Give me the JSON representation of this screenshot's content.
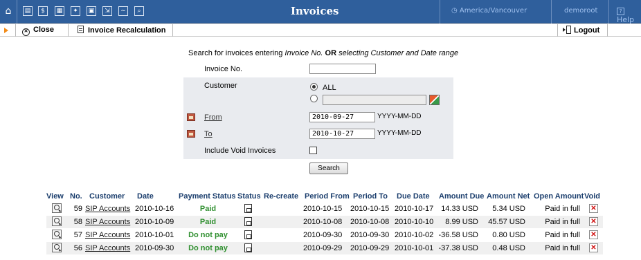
{
  "header": {
    "title": "Invoices",
    "timezone": "America/Vancouver",
    "user": "demoroot",
    "help": "Help",
    "nav_glyphs": [
      "⌂",
      "▤",
      "$",
      "▦",
      "✦",
      "▣",
      "⇲",
      "∼",
      "⌕"
    ]
  },
  "toolbar": {
    "close_label": "Close",
    "recalc_label": "Invoice Recalculation",
    "logout_label": "Logout"
  },
  "search": {
    "intro_1": "Search for invoices entering ",
    "intro_2": "Invoice No.",
    "intro_3": " OR ",
    "intro_4": "selecting Customer and Date range",
    "invoice_no_label": "Invoice No.",
    "invoice_no_value": "",
    "customer_label": "Customer",
    "customer_all_label": "ALL",
    "customer_value": "",
    "from_label": "From",
    "from_value": "2010-09-27",
    "to_label": "To",
    "to_value": "2010-10-27",
    "date_format": "YYYY-MM-DD",
    "void_label": "Include Void Invoices",
    "search_button": "Search"
  },
  "table": {
    "headers": [
      "View",
      "No.",
      "Customer",
      "Date",
      "Payment Status",
      "Status",
      "Re-create",
      "Period From",
      "Period To",
      "Due Date",
      "Amount Due",
      "Amount Net",
      "Open Amount",
      "Void"
    ],
    "rows": [
      {
        "no": "59",
        "customer": "SIP Accounts",
        "date": "2010-10-16",
        "payment_status": "Paid",
        "period_from": "2010-10-15",
        "period_to": "2010-10-15",
        "due_date": "2010-10-17",
        "amount_due": "14.33 USD",
        "amount_net": "5.34 USD",
        "open_amount": "Paid in full"
      },
      {
        "no": "58",
        "customer": "SIP Accounts",
        "date": "2010-10-09",
        "payment_status": "Paid",
        "period_from": "2010-10-08",
        "period_to": "2010-10-08",
        "due_date": "2010-10-10",
        "amount_due": "8.99 USD",
        "amount_net": "45.57 USD",
        "open_amount": "Paid in full"
      },
      {
        "no": "57",
        "customer": "SIP Accounts",
        "date": "2010-10-01",
        "payment_status": "Do not pay",
        "period_from": "2010-09-30",
        "period_to": "2010-09-30",
        "due_date": "2010-10-02",
        "amount_due": "-36.58 USD",
        "amount_net": "0.80 USD",
        "open_amount": "Paid in full"
      },
      {
        "no": "56",
        "customer": "SIP Accounts",
        "date": "2010-09-30",
        "payment_status": "Do not pay",
        "period_from": "2010-09-29",
        "period_to": "2010-09-29",
        "due_date": "2010-10-01",
        "amount_due": "-37.38 USD",
        "amount_net": "0.48 USD",
        "open_amount": "Paid in full"
      }
    ]
  },
  "colors": {
    "header_bg": "#2f5f9c",
    "header_text": "#ffffff",
    "paid_green": "#2f8f2f",
    "void_red": "#d01010",
    "accent_orange": "#f28c1a"
  }
}
